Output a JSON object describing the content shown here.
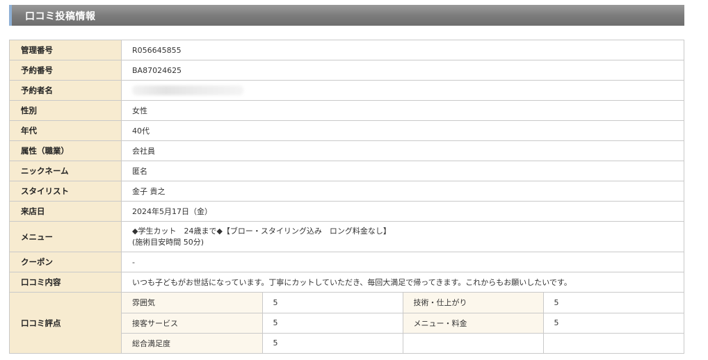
{
  "header": {
    "title": "口コミ投稿情報"
  },
  "rows": {
    "management_no": {
      "label": "管理番号",
      "value": "R056645855"
    },
    "reservation_no": {
      "label": "予約番号",
      "value": "BA87024625"
    },
    "reserver_name": {
      "label": "予約者名",
      "value": ""
    },
    "gender": {
      "label": "性別",
      "value": "女性"
    },
    "age": {
      "label": "年代",
      "value": "40代"
    },
    "occupation": {
      "label": "属性（職業）",
      "value": "会社員"
    },
    "nickname": {
      "label": "ニックネーム",
      "value": "匿名"
    },
    "stylist": {
      "label": "スタイリスト",
      "value": "金子 貴之"
    },
    "visit_date": {
      "label": "来店日",
      "value": "2024年5月17日（金）"
    },
    "menu": {
      "label": "メニュー",
      "line1": "◆学生カット　24歳まで◆【ブロー・スタイリング込み　ロング料金なし】",
      "line2": "(施術目安時間 50分)"
    },
    "coupon": {
      "label": "クーポン",
      "value": "-"
    },
    "review_content": {
      "label": "口コミ内容",
      "value": "いつも子どもがお世話になっています。丁寧にカットしていただき、毎回大満足で帰ってきます。これからもお願いしたいです。"
    },
    "rating": {
      "label": "口コミ評点",
      "items": [
        {
          "label": "雰囲気",
          "value": "5"
        },
        {
          "label": "技術・仕上がり",
          "value": "5"
        },
        {
          "label": "接客サービス",
          "value": "5"
        },
        {
          "label": "メニュー・料金",
          "value": "5"
        },
        {
          "label": "総合満足度",
          "value": "5"
        }
      ]
    }
  },
  "colors": {
    "header_gradient_top": "#9a9a9a",
    "header_gradient_bottom": "#6e6e6e",
    "header_accent": "#8fb1d6",
    "label_cell_bg": "#f7ebd0",
    "rating_label_bg": "#fcf7ec",
    "border": "#c9c9c9"
  }
}
